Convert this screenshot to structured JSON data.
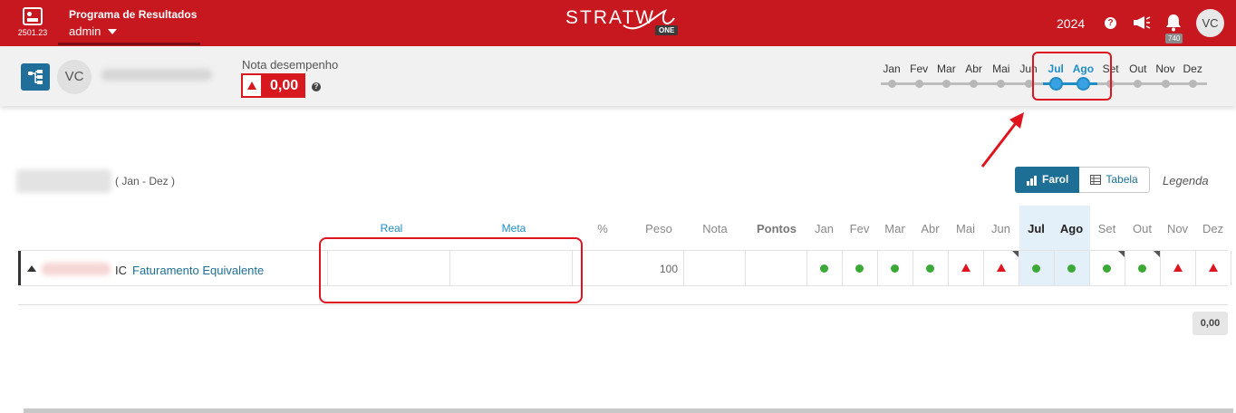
{
  "topbar": {
    "app_version": "2501.23",
    "program_title": "Programa de Resultados",
    "user": "admin",
    "logo_text": "STRATW",
    "logo_badge": "ONE",
    "year": "2024",
    "help_icon": "?",
    "notification_count": "740",
    "avatar_initials": "VC",
    "brand_color": "#c8181f"
  },
  "subheader": {
    "avatar_initials": "VC",
    "nota_label": "Nota desempenho",
    "nota_value": "0,00",
    "help_icon": "?",
    "months": [
      "Jan",
      "Fev",
      "Mar",
      "Abr",
      "Mai",
      "Jun",
      "Jul",
      "Ago",
      "Set",
      "Out",
      "Nov",
      "Dez"
    ],
    "selected_months": [
      "Jul",
      "Ago"
    ],
    "accent_color": "#1f8dc6"
  },
  "main": {
    "period": "( Jan - Dez )",
    "view_farol": "Farol",
    "view_tabela": "Tabela",
    "legenda": "Legenda",
    "columns": {
      "real": "Real",
      "meta": "Meta",
      "percent": "%",
      "peso": "Peso",
      "nota": "Nota",
      "pontos": "Pontos"
    },
    "row": {
      "prefix": "IC",
      "name": "Faturamento Equivalente",
      "peso": "100",
      "status": [
        "green",
        "green",
        "green",
        "green",
        "red",
        "red",
        "green",
        "green",
        "green",
        "green",
        "red",
        "red"
      ]
    },
    "total": "0,00"
  }
}
